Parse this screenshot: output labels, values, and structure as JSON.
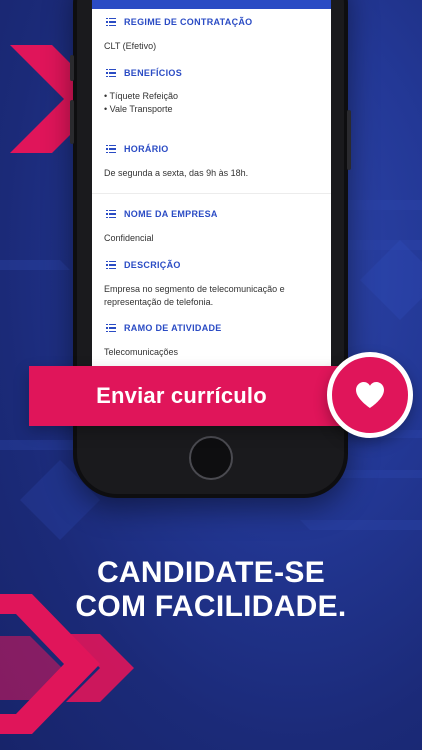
{
  "job_sections": [
    {
      "title": "REGIME DE CONTRATAÇÃO",
      "text": "CLT (Efetivo)"
    },
    {
      "title": "BENEFÍCIOS",
      "items": [
        "• Tíquete Refeição",
        "• Vale Transporte"
      ]
    },
    {
      "title": "HORÁRIO",
      "text": "De segunda a sexta, das 9h às 18h."
    },
    {
      "title": "NOME DA EMPRESA",
      "text": "Confidencial"
    },
    {
      "title": "DESCRIÇÃO",
      "lines": [
        "Empresa no segmento de telecomunicação e",
        "representação de telefonia."
      ]
    },
    {
      "title": "RAMO DE ATIVIDADE",
      "text": "Telecomunicações"
    }
  ],
  "cta": {
    "label": "Enviar currículo",
    "icon": "heart-icon"
  },
  "headline": {
    "line1": "CANDIDATE-SE",
    "line2": "COM FACILIDADE."
  },
  "colors": {
    "background": "#1f2f82",
    "accent": "#e0155a",
    "link_blue": "#2a4bc4",
    "white": "#ffffff"
  }
}
